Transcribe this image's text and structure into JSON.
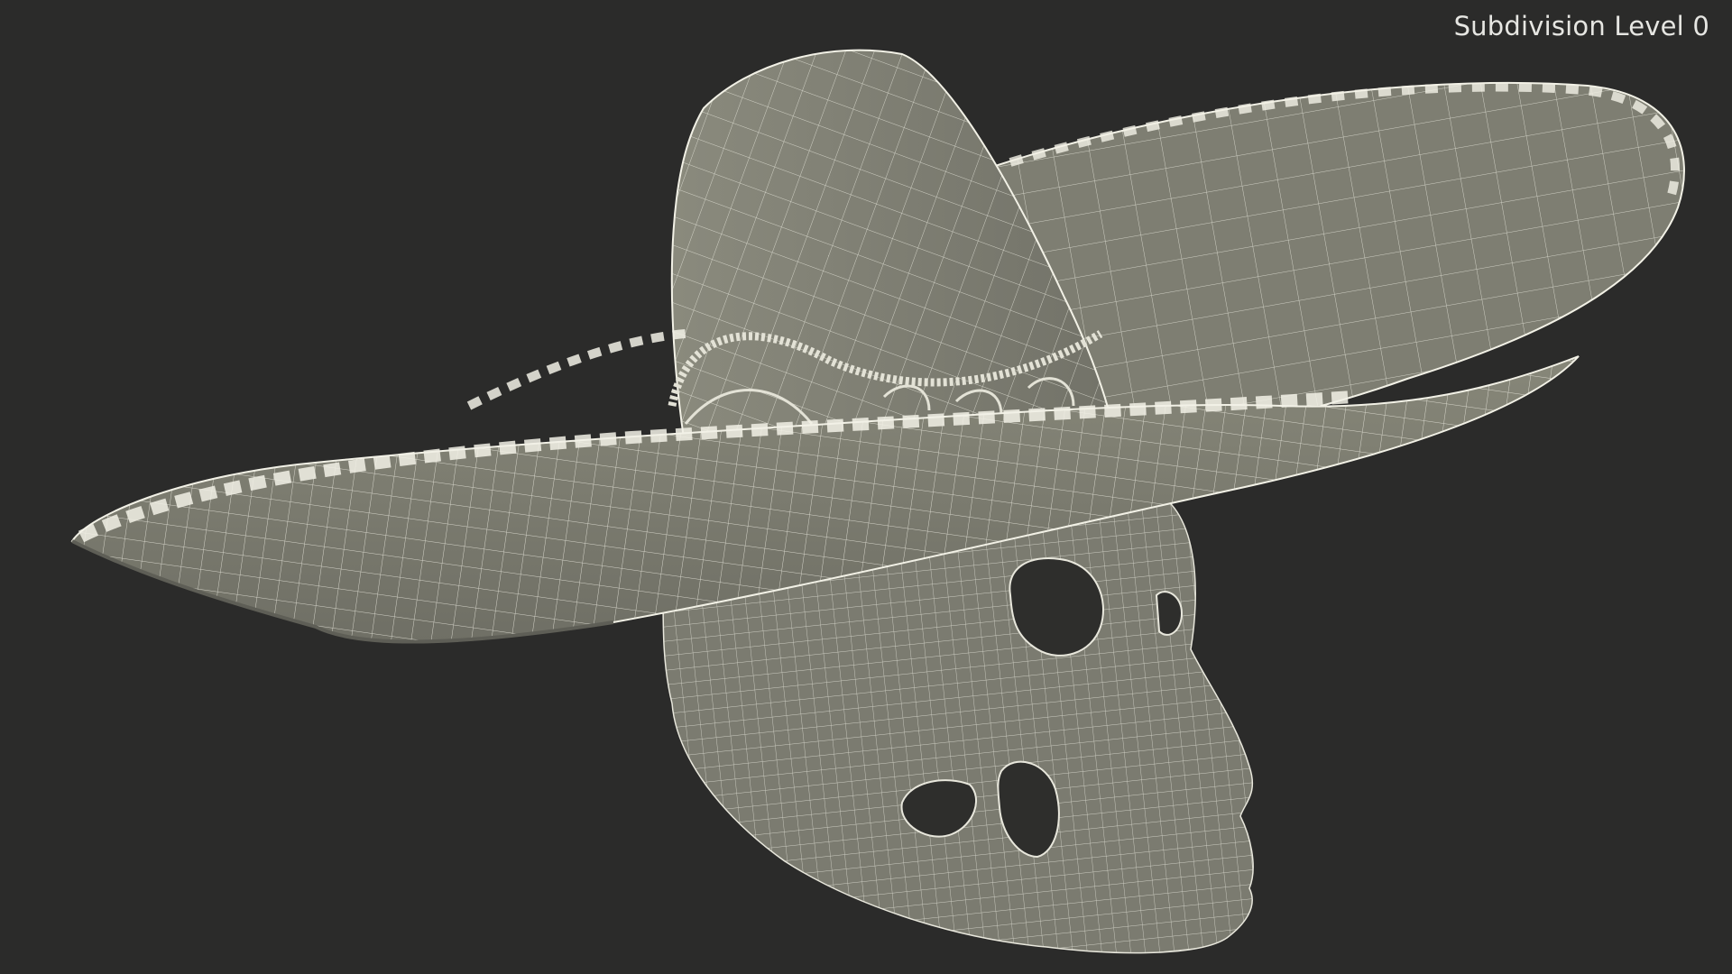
{
  "viewport": {
    "subdivision_label": "Subdivision Level 0",
    "background_color": "#2b2b2a",
    "mesh_fill_color": "#7b7b70",
    "wire_color": "#f2f1e6"
  },
  "scene": {
    "objects": [
      "sombrero-hat-mesh",
      "skull-mesh"
    ]
  }
}
